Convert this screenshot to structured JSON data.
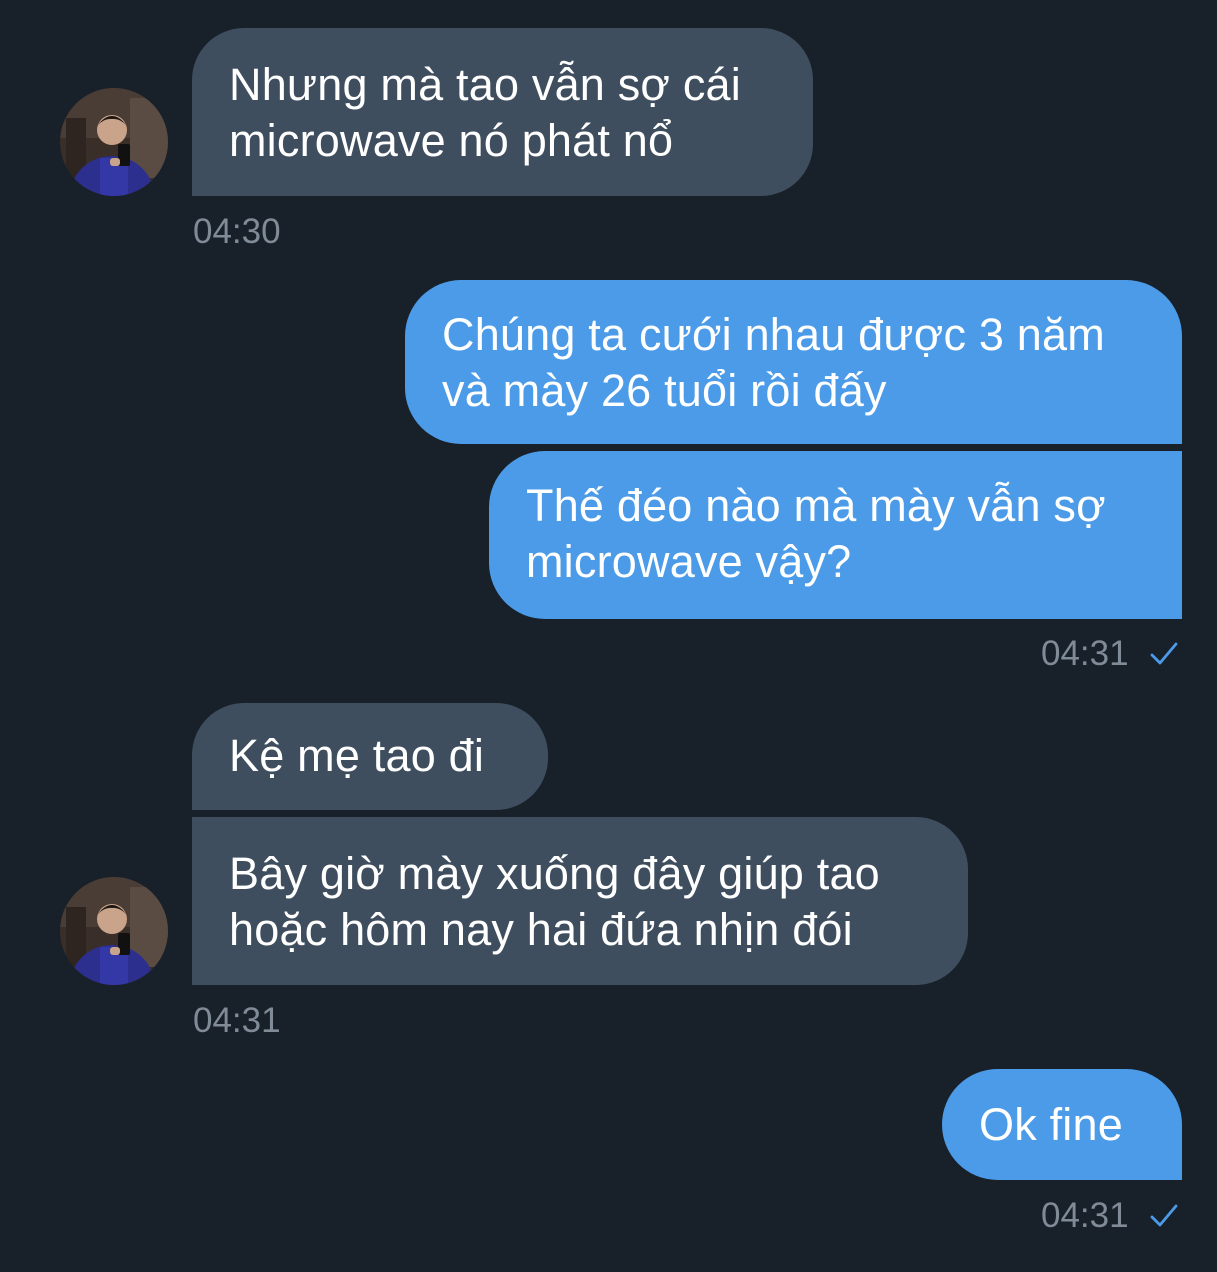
{
  "messages": [
    {
      "id": "m1",
      "direction": "incoming",
      "text": "Nhưng mà tao vẫn sợ cái microwave nó phát nổ"
    },
    {
      "id": "m2",
      "direction": "outgoing",
      "text": "Chúng ta cưới nhau được 3 năm và mày 26 tuổi rồi đấy"
    },
    {
      "id": "m3",
      "direction": "outgoing",
      "text": "Thế đéo nào mà mày vẫn sợ microwave vậy?"
    },
    {
      "id": "m4",
      "direction": "incoming",
      "text": "Kệ mẹ tao đi"
    },
    {
      "id": "m5",
      "direction": "incoming",
      "text": "Bây giờ mày xuống đây giúp tao hoặc hôm nay hai đứa nhịn đói"
    },
    {
      "id": "m6",
      "direction": "outgoing",
      "text": "Ok fine"
    }
  ],
  "timestamps": {
    "t1": "04:30",
    "t2": "04:31",
    "t3": "04:31",
    "t4": "04:31"
  },
  "icons": {
    "read_receipt": "check-icon",
    "avatar": "contact-avatar"
  },
  "colors": {
    "background": "#18202a",
    "incoming_bubble": "#3f4e5e",
    "outgoing_bubble": "#4c9be8",
    "timestamp": "#808b98",
    "check": "#4c9be8"
  }
}
